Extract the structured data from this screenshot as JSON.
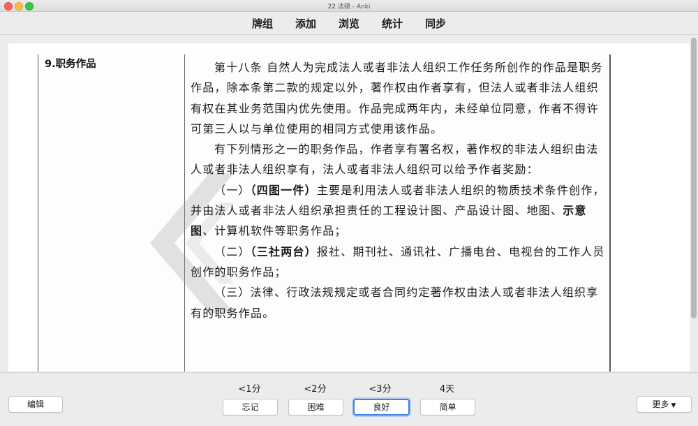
{
  "window": {
    "title": "22 法硕 - Anki"
  },
  "nav": {
    "decks": "牌组",
    "add": "添加",
    "browse": "浏览",
    "stats": "统计",
    "sync": "同步"
  },
  "card": {
    "heading": "9.职务作品",
    "para1": "第十八条 自然人为完成法人或者非法人组织工作任务所创作的作品是职务作品，除本条第二款的规定以外，著作权由作者享有，但法人或者非法人组织有权在其业务范围内优先使用。作品完成两年内，未经单位同意，作者不得许可第三人以与单位使用的相同方式使用该作品。",
    "para2": "有下列情形之一的职务作品，作者享有署名权，著作权的非法人组织由法人或者非法人组织享有，法人或者非法人组织可以给予作者奖励：",
    "item1": {
      "prefix": "（一）",
      "bold": "（四图一件）",
      "text_a": "主要是利用法人或者非法人组织的物质技术条件创作，并由法人或者非法人组织承担责任的工程设计图、产品设计图、地图、",
      "bold2": "示意图",
      "text_b": "、计算机软件等职务作品；"
    },
    "item2": {
      "prefix": "（二）",
      "bold": "（三社两台）",
      "text": "报社、期刊社、通讯社、广播电台、电视台的工作人员创作的职务作品；"
    },
    "item3": {
      "text": "（三）法律、行政法规规定或者合同约定著作权由法人或者非法人组织享有的职务作品。"
    }
  },
  "bottom": {
    "edit": "编辑",
    "more": "更多",
    "answers": [
      {
        "interval": "<1分",
        "label": "忘记"
      },
      {
        "interval": "<2分",
        "label": "困难"
      },
      {
        "interval": "<3分",
        "label": "良好"
      },
      {
        "interval": "4天",
        "label": "简单"
      }
    ]
  },
  "colors": {
    "close": "#fc605c",
    "minimize": "#fdbc40",
    "maximize": "#34c84a",
    "focus_ring": "#3b82e6"
  }
}
